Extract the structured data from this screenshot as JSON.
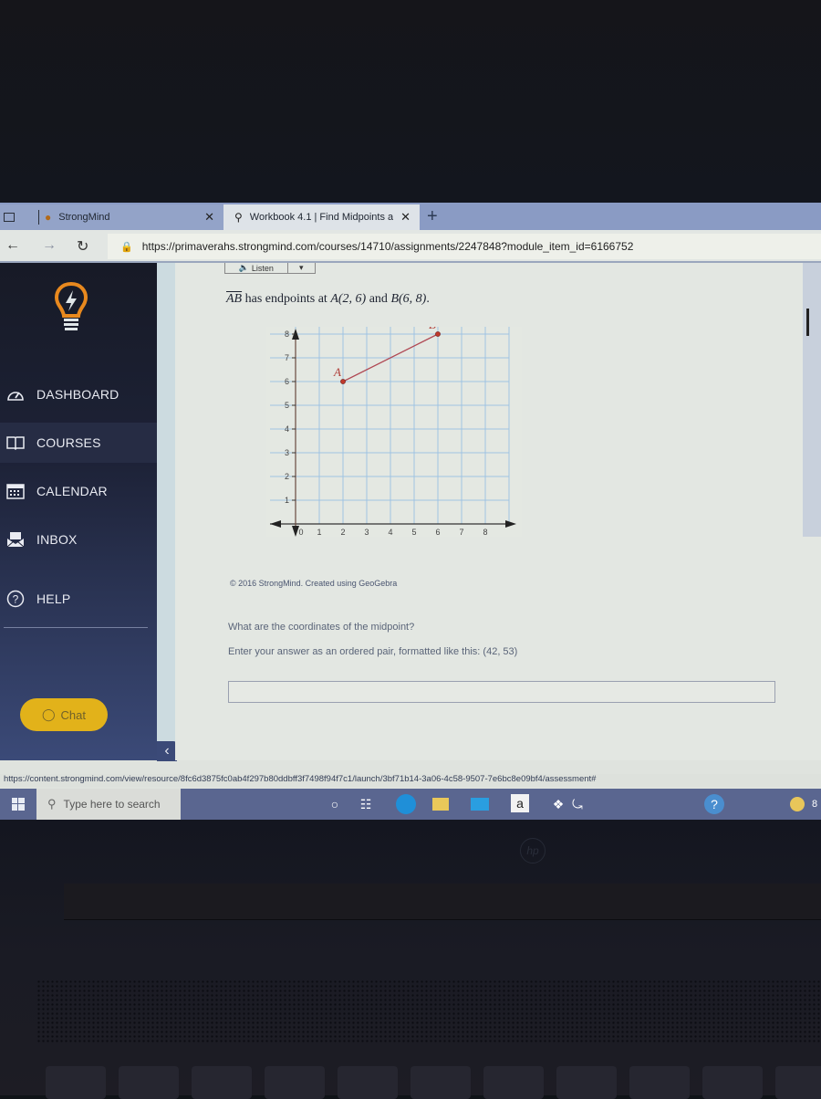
{
  "browser": {
    "tabs": [
      {
        "label": "StrongMind",
        "active": false
      },
      {
        "label": "Workbook 4.1 | Find Midpoints a",
        "active": true
      }
    ],
    "new_tab_icon": "plus-icon",
    "url": "https://primaverahs.strongmind.com/courses/14710/assignments/2247848?module_item_id=6166752",
    "status_url": "https://content.strongmind.com/view/resource/8fc6d3875fc0ab4f297b80ddbff3f7498f94f7c1/launch/3bf71b14-3a06-4c58-9507-7e6bc8e09bf4/assessment#"
  },
  "sidebar": {
    "items": [
      {
        "label": "DASHBOARD",
        "icon": "dashboard-gauge-icon",
        "active": false
      },
      {
        "label": "COURSES",
        "icon": "book-icon",
        "active": true
      },
      {
        "label": "CALENDAR",
        "icon": "calendar-icon",
        "active": false
      },
      {
        "label": "INBOX",
        "icon": "inbox-icon",
        "active": false
      },
      {
        "label": "HELP",
        "icon": "help-icon",
        "active": false
      }
    ],
    "chat_label": "Chat",
    "collapse_icon": "chevron-left-icon"
  },
  "content": {
    "listen_label": "Listen",
    "question": {
      "segment": "AB",
      "text_mid": " has endpoints at ",
      "pointA": "A(2, 6)",
      "and": " and ",
      "pointB": "B(6, 8)",
      "end": "."
    },
    "credit": "© 2016 StrongMind. Created using GeoGebra",
    "prompt": "What are the coordinates of the midpoint?",
    "hint": "Enter your answer as an ordered pair, formatted like this: (42, 53)",
    "answer_value": ""
  },
  "chart_data": {
    "type": "scatter",
    "title": "",
    "xlabel": "",
    "ylabel": "",
    "xlim": [
      0,
      8
    ],
    "ylim": [
      0,
      8
    ],
    "x_ticks": [
      "0",
      "1",
      "2",
      "3",
      "4",
      "5",
      "6",
      "7",
      "8"
    ],
    "y_ticks": [
      "1",
      "2",
      "3",
      "4",
      "5",
      "6",
      "7",
      "8"
    ],
    "grid": true,
    "points": [
      {
        "label": "A",
        "x": 2,
        "y": 6
      },
      {
        "label": "B",
        "x": 6,
        "y": 8
      }
    ],
    "segments": [
      {
        "from": "A",
        "to": "B"
      }
    ],
    "colors": {
      "grid": "#9fc3e3",
      "segment": "#b04a55",
      "point": "#c0392b"
    }
  },
  "taskbar": {
    "search_placeholder": "Type here to search",
    "icons": [
      "cortana-icon",
      "task-view-icon",
      "edge-icon",
      "file-explorer-icon",
      "mail-icon",
      "amazon-icon",
      "dropbox-icon",
      "app-icon",
      "help-tips-icon",
      "weather-icon"
    ],
    "amazon_glyph": "a",
    "weather_text": "8"
  },
  "laptop": {
    "brand": "hp"
  }
}
